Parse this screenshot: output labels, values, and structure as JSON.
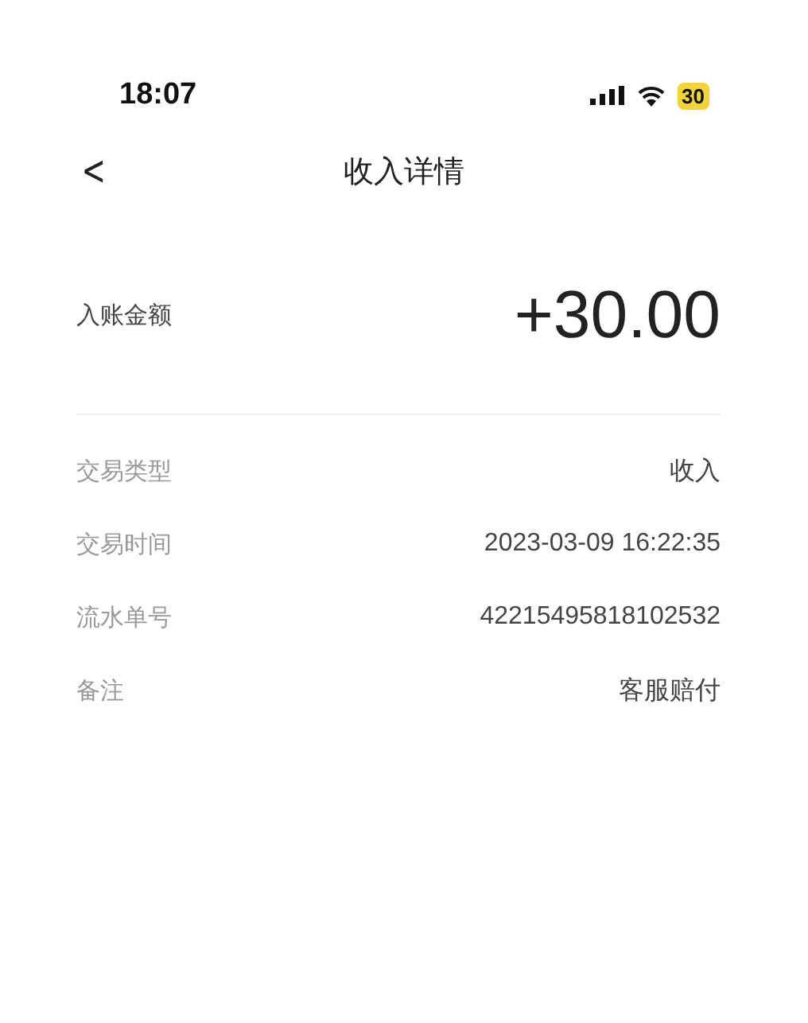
{
  "status_bar": {
    "time": "18:07",
    "battery": "30"
  },
  "nav": {
    "back": "<",
    "title": "收入详情"
  },
  "amount": {
    "label": "入账金额",
    "value": "+30.00"
  },
  "details": [
    {
      "label": "交易类型",
      "value": "收入"
    },
    {
      "label": "交易时间",
      "value": "2023-03-09 16:22:35"
    },
    {
      "label": "流水单号",
      "value": "42215495818102532"
    },
    {
      "label": "备注",
      "value": "客服赔付"
    }
  ]
}
